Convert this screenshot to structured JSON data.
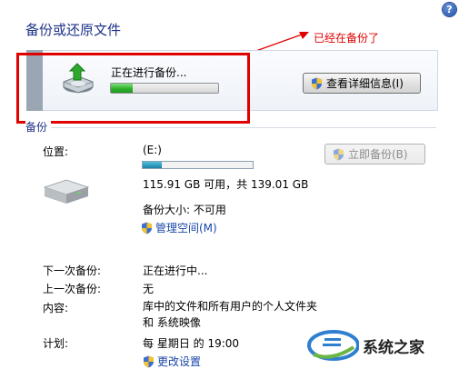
{
  "window": {
    "title": "备份或还原文件",
    "help_symbol": "?"
  },
  "annotation": {
    "text": "已经在备份了",
    "color": "#e00000"
  },
  "progress_panel": {
    "status": "正在进行备份...",
    "progress_fraction": 0.2,
    "details_button": "查看详细信息(I)"
  },
  "backup_section": {
    "title": "备份",
    "location_label": "位置:",
    "drive": "(E:)",
    "used_fraction": 0.17,
    "space_text": "115.91 GB 可用，共 139.01 GB",
    "backup_size_text": "备份大小: 不可用",
    "manage_space_link": "管理空间(M)",
    "backup_now_button": "立即备份(B)",
    "rows": [
      {
        "label": "下一次备份:",
        "value": "正在进行中..."
      },
      {
        "label": "上一次备份:",
        "value": "无"
      },
      {
        "label": "内容:",
        "value": "库中的文件和所有用户的个人文件夹 和 系统映像"
      },
      {
        "label": "计划:",
        "value": "每 星期日 的 19:00"
      }
    ],
    "change_settings_link": "更改设置"
  },
  "watermark": {
    "text": "系统之家"
  }
}
